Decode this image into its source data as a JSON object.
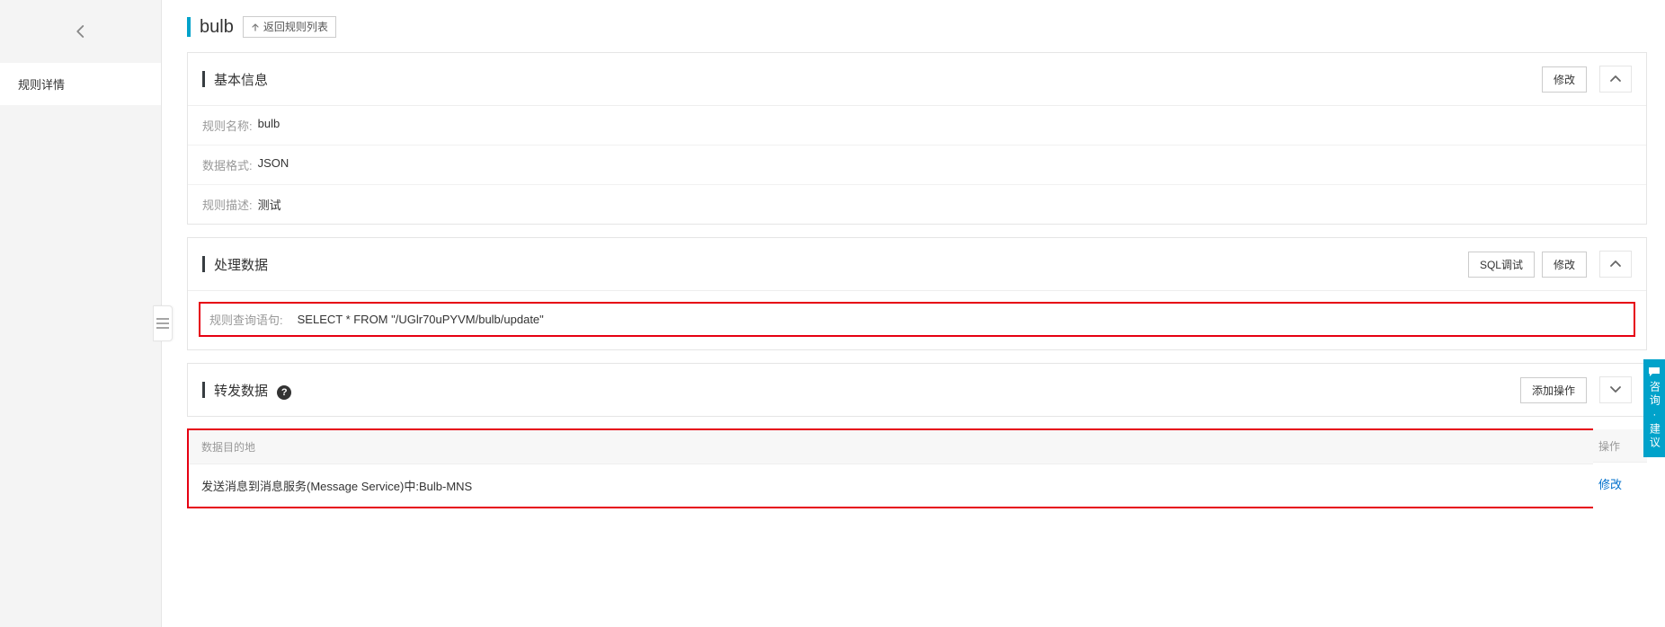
{
  "sidebar": {
    "items": [
      {
        "label": "规则详情"
      }
    ]
  },
  "header": {
    "title": "bulb",
    "back_button": "返回规则列表"
  },
  "panels": {
    "basic": {
      "title": "基本信息",
      "modify_btn": "修改",
      "rows": {
        "name_label": "规则名称:",
        "name_value": "bulb",
        "format_label": "数据格式:",
        "format_value": "JSON",
        "desc_label": "规则描述:",
        "desc_value": "测试"
      }
    },
    "process": {
      "title": "处理数据",
      "sql_debug_btn": "SQL调试",
      "modify_btn": "修改",
      "sql_label": "规则查询语句:",
      "sql_value": "SELECT * FROM \"/UGlr70uPYVM/bulb/update\""
    },
    "forward": {
      "title": "转发数据",
      "add_btn": "添加操作",
      "col_dest": "数据目的地",
      "col_action": "操作",
      "row1_dest": "发送消息到消息服务(Message Service)中:Bulb-MNS",
      "row1_action": "修改"
    }
  },
  "feedback": {
    "label": "咨询·建议"
  }
}
